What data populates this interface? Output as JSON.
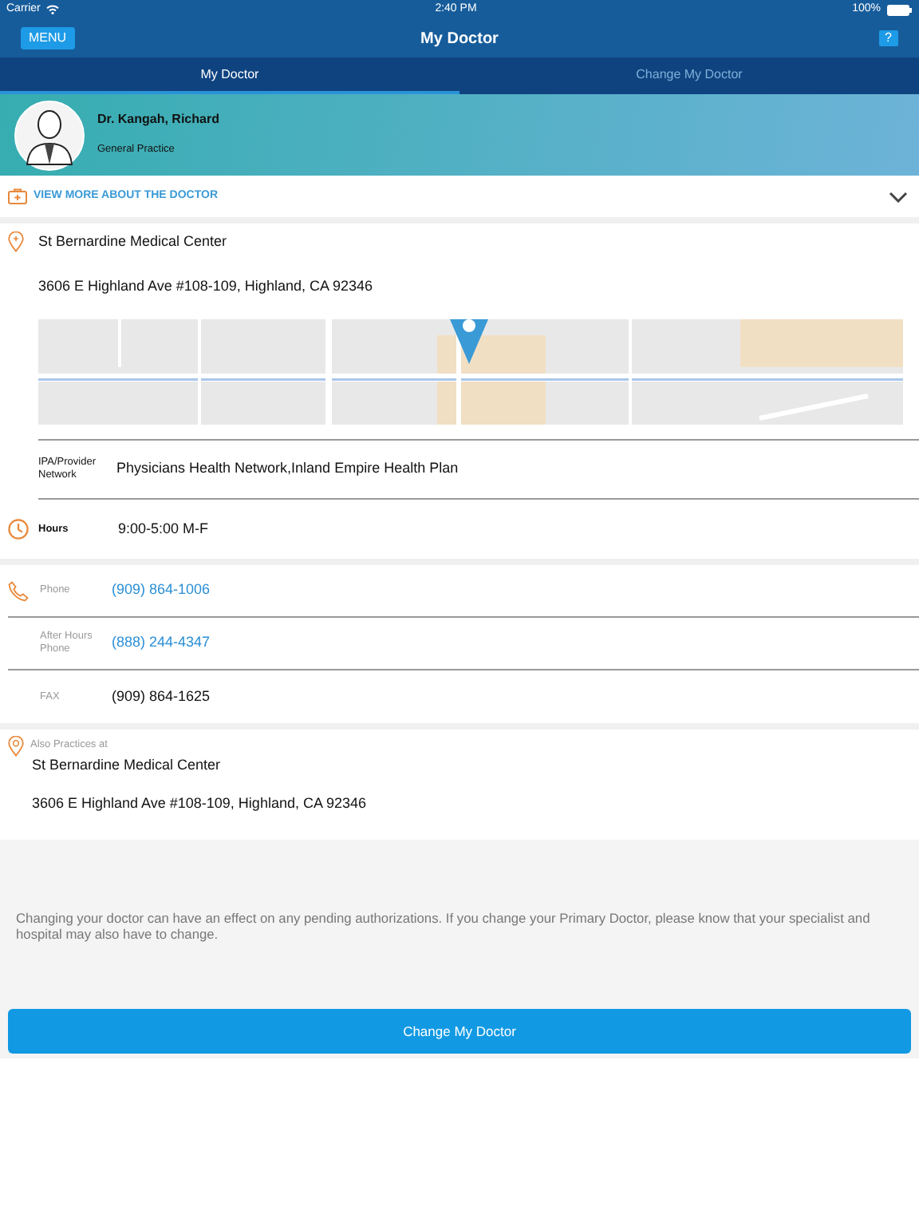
{
  "status_bar": {
    "carrier": "Carrier",
    "time": "2:40 PM",
    "battery": "100%"
  },
  "nav": {
    "menu_button": "MENU",
    "title": "My Doctor",
    "help_button": "?"
  },
  "tabs": [
    {
      "label": "My Doctor",
      "selected": true
    },
    {
      "label": "Change My Doctor",
      "selected": false
    }
  ],
  "doctor": {
    "name": "Dr. Kangah, Richard",
    "specialty": "General Practice"
  },
  "view_more": {
    "label": "VIEW MORE ABOUT THE DOCTOR",
    "expanded": false
  },
  "location": {
    "name": "St Bernardine Medical Center",
    "address": "3606 E Highland Ave #108-109, Highland, CA 92346"
  },
  "network": {
    "label": "IPA/Provider Network",
    "value": "Physicians Health Network,Inland Empire Health Plan"
  },
  "hours": {
    "label": "Hours",
    "value": "9:00-5:00 M-F"
  },
  "contacts": [
    {
      "label": "Phone",
      "value": "(909) 864-1006",
      "kind": "link"
    },
    {
      "label": "After Hours Phone",
      "value": "(888) 244-4347",
      "kind": "link"
    },
    {
      "label": "FAX",
      "value": "(909) 864-1625",
      "kind": "plain"
    }
  ],
  "also_practices": {
    "label": "Also Practices at",
    "name": "St Bernardine Medical Center",
    "address": "3606 E Highland Ave #108-109, Highland, CA 92346"
  },
  "notice": "Changing your doctor can have an effect on any pending authorizations. If you change your Primary Doctor, please know that your specialist and hospital may also have to change.",
  "action_button": "Change My Doctor"
}
